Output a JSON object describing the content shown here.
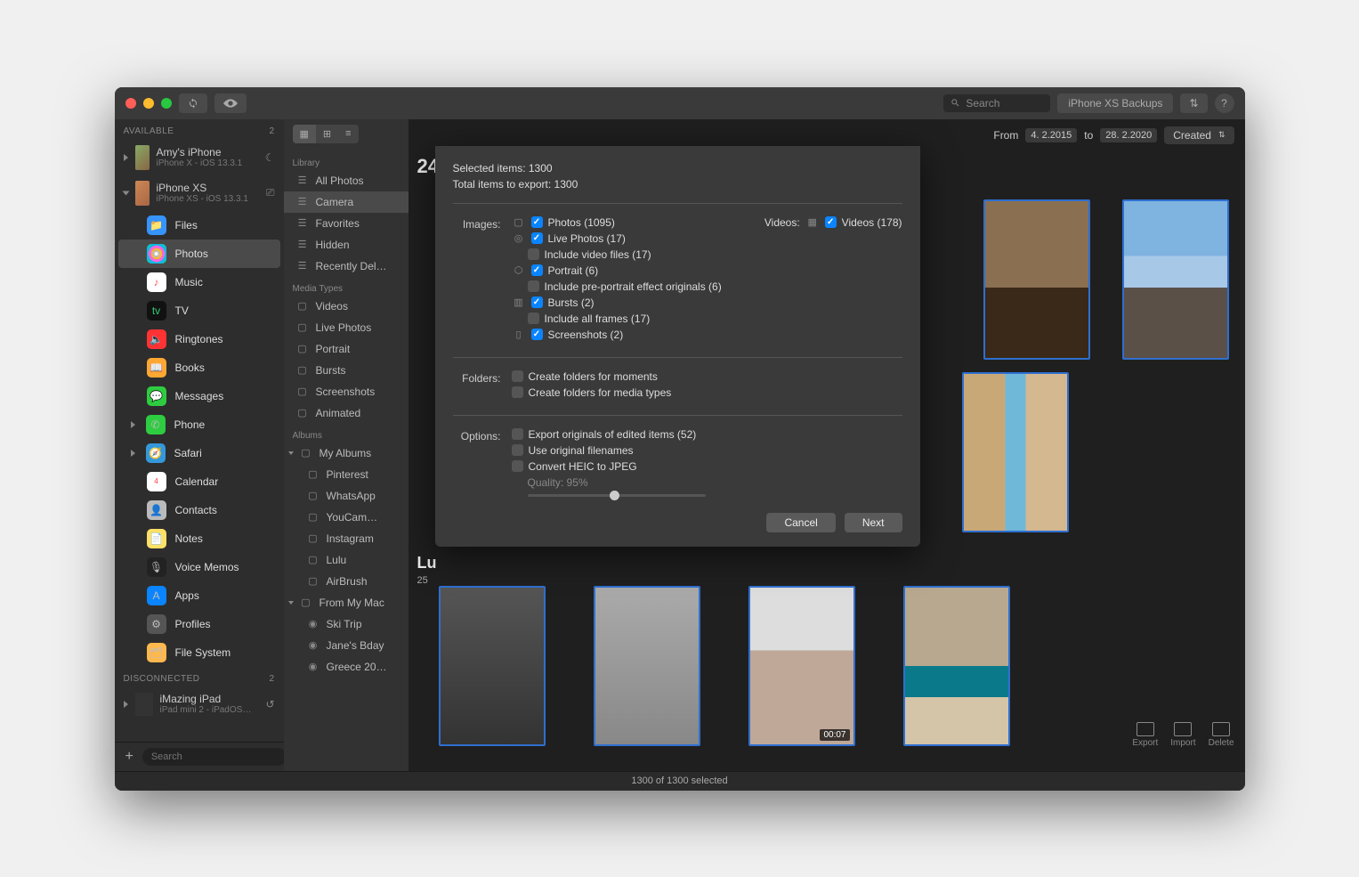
{
  "titlebar": {
    "search_placeholder": "Search",
    "backup_button": "iPhone XS Backups"
  },
  "sidebar": {
    "sections": {
      "available": {
        "label": "AVAILABLE",
        "count": "2"
      },
      "disconnected": {
        "label": "DISCONNECTED",
        "count": "2"
      }
    },
    "devices": [
      {
        "name": "Amy's iPhone",
        "sub": "iPhone X - iOS 13.3.1"
      },
      {
        "name": "iPhone XS",
        "sub": "iPhone XS - iOS 13.3.1"
      },
      {
        "name": "iMazing iPad",
        "sub": "iPad mini 2 - iPadOS…"
      }
    ],
    "apps": [
      {
        "label": "Files",
        "icon": "files"
      },
      {
        "label": "Photos",
        "icon": "photos",
        "selected": true
      },
      {
        "label": "Music",
        "icon": "music"
      },
      {
        "label": "TV",
        "icon": "tv"
      },
      {
        "label": "Ringtones",
        "icon": "ring"
      },
      {
        "label": "Books",
        "icon": "books"
      },
      {
        "label": "Messages",
        "icon": "msg"
      },
      {
        "label": "Phone",
        "icon": "phone"
      },
      {
        "label": "Safari",
        "icon": "safari"
      },
      {
        "label": "Calendar",
        "icon": "cal"
      },
      {
        "label": "Contacts",
        "icon": "contacts"
      },
      {
        "label": "Notes",
        "icon": "notes"
      },
      {
        "label": "Voice Memos",
        "icon": "voice"
      },
      {
        "label": "Apps",
        "icon": "apps"
      },
      {
        "label": "Profiles",
        "icon": "profiles"
      },
      {
        "label": "File System",
        "icon": "fs"
      }
    ],
    "footer_search": "Search"
  },
  "middle": {
    "library_label": "Library",
    "library": [
      "All Photos",
      "Camera",
      "Favorites",
      "Hidden",
      "Recently Del…"
    ],
    "media_label": "Media Types",
    "media": [
      "Videos",
      "Live Photos",
      "Portrait",
      "Bursts",
      "Screenshots",
      "Animated"
    ],
    "albums_label": "Albums",
    "albums_group1": "My Albums",
    "albums1": [
      "Pinterest",
      "WhatsApp",
      "YouCam…",
      "Instagram",
      "Lulu",
      "AirBrush"
    ],
    "albums_group2": "From My Mac",
    "albums2": [
      "Ski Trip",
      "Jane's Bday",
      "Greece 20…"
    ]
  },
  "content": {
    "count_partial": "24",
    "from_label": "From",
    "from_date": "4.  2.2015",
    "to_label": "to",
    "to_date": "28.  2.2020",
    "sort": "Created",
    "section_title": "Lu",
    "section_sub": "25",
    "status": "1300 of 1300 selected",
    "thumbs_bottom_duration": "00:07",
    "actions": {
      "export": "Export",
      "import": "Import",
      "delete": "Delete"
    }
  },
  "dialog": {
    "selected": "Selected items: 1300",
    "total": "Total items to export: 1300",
    "images_label": "Images:",
    "videos_label": "Videos:",
    "folders_label": "Folders:",
    "options_label": "Options:",
    "photo": "Photos (1095)",
    "live": "Live Photos (17)",
    "live_sub": "Include video files (17)",
    "portrait": "Portrait (6)",
    "portrait_sub": "Include pre-portrait effect originals (6)",
    "bursts": "Bursts (2)",
    "bursts_sub": "Include all frames (17)",
    "screenshots": "Screenshots (2)",
    "videos": "Videos (178)",
    "folders_moments": "Create folders for moments",
    "folders_media": "Create folders for media types",
    "opt_originals": "Export originals of edited items (52)",
    "opt_filenames": "Use original filenames",
    "opt_heic": "Convert HEIC to JPEG",
    "quality": "Quality: 95%",
    "cancel": "Cancel",
    "next": "Next"
  }
}
